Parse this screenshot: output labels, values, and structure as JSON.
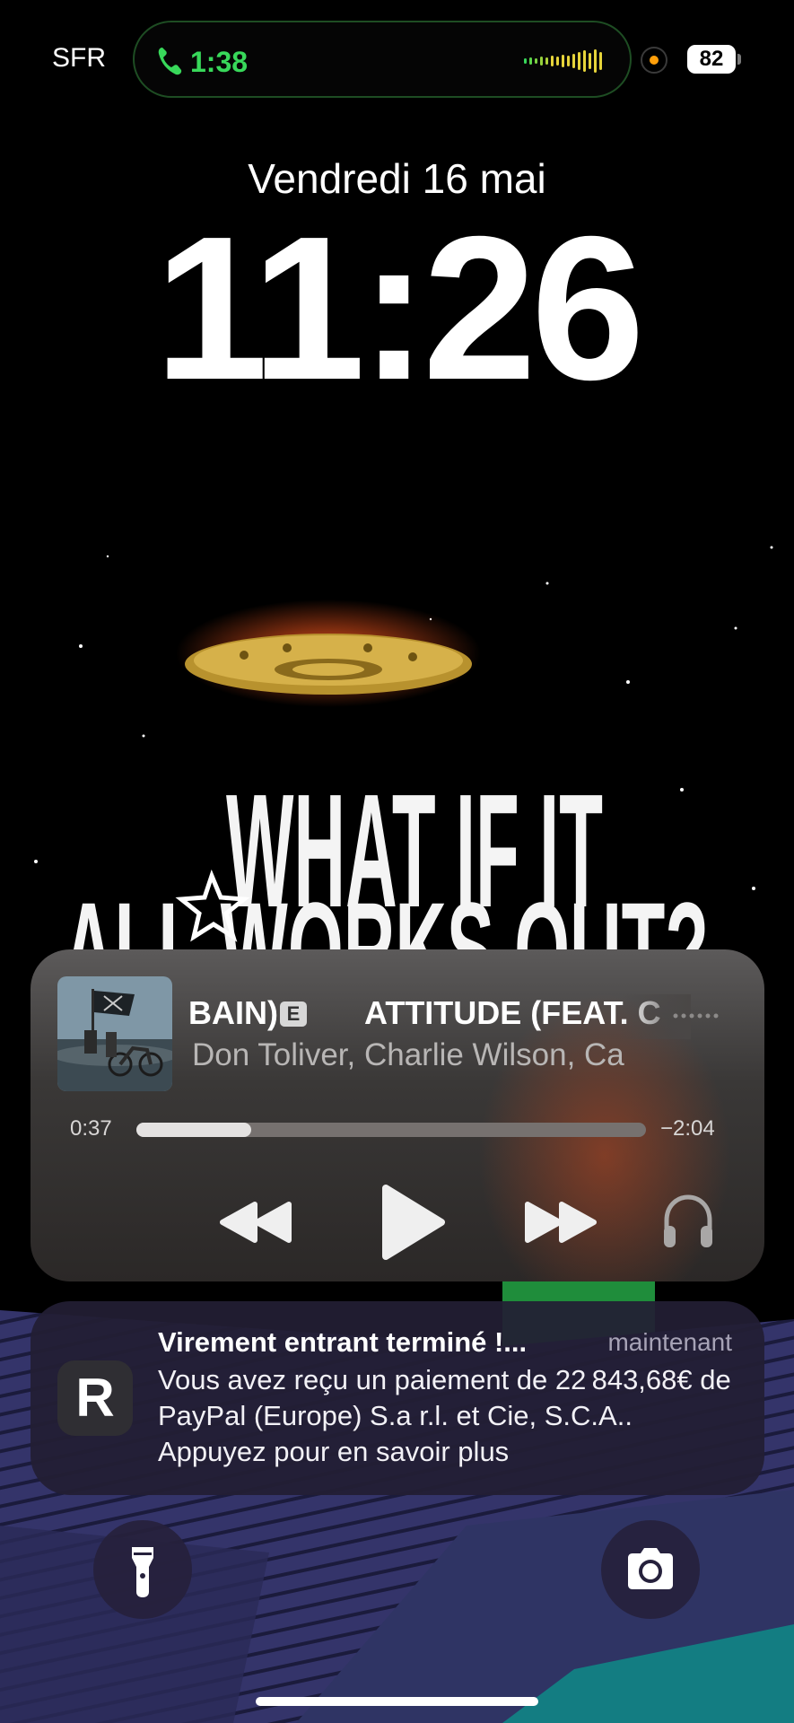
{
  "status_bar": {
    "carrier": "SFR",
    "call_timer": "1:38",
    "battery_level": "82",
    "call_color": "#38d85a",
    "recording_indicator_color": "#ff9f0a"
  },
  "lock_screen": {
    "date": "Vendredi 16 mai",
    "time": "11:26"
  },
  "wallpaper": {
    "headline": "WHAT IF IT",
    "subline": "ALL WORKS OUT?"
  },
  "now_playing": {
    "title_left": "BAIN)",
    "explicit_badge": "E",
    "title_right": "ATTITUDE (FEAT. C",
    "artists": "Don Toliver, Charlie Wilson, Ca",
    "elapsed": "0:37",
    "remaining": "−2:04",
    "progress_fraction": 0.226,
    "controls": {
      "rewind_icon": "backward-icon",
      "play_icon": "play-icon",
      "forward_icon": "forward-icon",
      "output_icon": "headphones-icon"
    }
  },
  "notification": {
    "app_icon": "revolut-icon",
    "app_letter": "R",
    "title": "Virement entrant terminé !...",
    "time": "maintenant",
    "body": "Vous avez reçu un paiement de 22 843,68€ de PayPal (Europe) S.a r.l. et Cie, S.C.A.. Appuyez pour en savoir plus"
  },
  "quick_actions": {
    "left_icon": "flashlight-icon",
    "right_icon": "camera-icon"
  }
}
